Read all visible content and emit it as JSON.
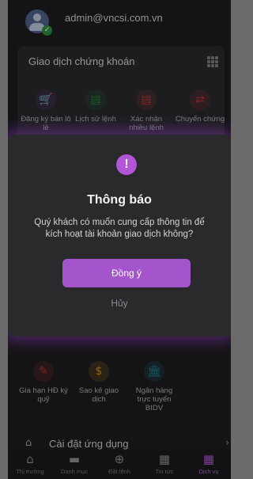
{
  "header": {
    "email": "admin@vncsi.com.vn"
  },
  "card": {
    "title": "Giao dịch chứng khoán",
    "tiles": [
      {
        "icon": "cart-icon",
        "glyph": "🛒",
        "color": "#7c3aa6",
        "label": "Đăng ký bán lô lẻ"
      },
      {
        "icon": "document-icon",
        "glyph": "▤",
        "color": "#1f7a3a",
        "label": "Lịch sử lệnh"
      },
      {
        "icon": "confirm-document-icon",
        "glyph": "▤",
        "color": "#b23a3a",
        "label": "Xác nhận nhiều lệnh"
      },
      {
        "icon": "transfer-icon",
        "glyph": "⇄",
        "color": "#b2303a",
        "label": "Chuyển chứng"
      }
    ]
  },
  "lower_tiles": [
    {
      "icon": "extend-contract-icon",
      "glyph": "✎",
      "color": "#b23232",
      "label": "Gia hạn HĐ ký quỹ"
    },
    {
      "icon": "statement-icon",
      "glyph": "$",
      "color": "#c58a1a",
      "label": "Sao kê giao dịch"
    },
    {
      "icon": "bank-icon",
      "glyph": "🏛",
      "color": "#1f7a8a",
      "label": "Ngân hàng trực tuyến BIDV"
    }
  ],
  "settings": {
    "label": "Cài đặt ứng dụng"
  },
  "modal": {
    "icon": "!",
    "title": "Thông báo",
    "message": "Quý khách có muốn cung cấp thông tin để kích hoạt tài khoản giao dịch không?",
    "ok_label": "Đồng ý",
    "cancel_label": "Hủy"
  },
  "nav": [
    {
      "icon": "home-icon",
      "glyph": "⌂",
      "label": "Thị trường",
      "active": false
    },
    {
      "icon": "folder-icon",
      "glyph": "▬",
      "label": "Danh mục",
      "active": false
    },
    {
      "icon": "order-icon",
      "glyph": "⊕",
      "label": "Đặt lệnh",
      "active": false
    },
    {
      "icon": "news-icon",
      "glyph": "▦",
      "label": "Tin tức",
      "active": false
    },
    {
      "icon": "services-icon",
      "glyph": "▦",
      "label": "Dịch vụ",
      "active": true
    }
  ],
  "colors": {
    "accent": "#a455cc",
    "background": "#1d1d1f",
    "modal": "#2a2a2d"
  }
}
